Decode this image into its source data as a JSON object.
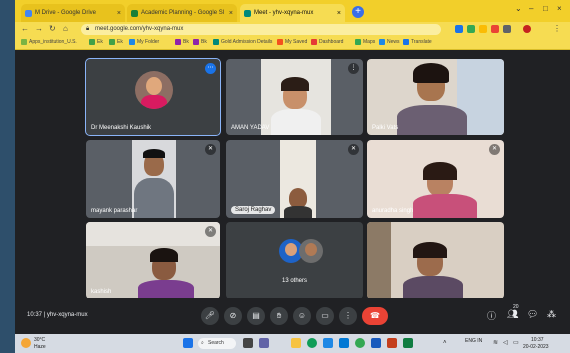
{
  "browser": {
    "tabs": [
      {
        "label": "M Drive - Google Drive",
        "color": "#4285f4"
      },
      {
        "label": "Academic Planning - Google Sl",
        "color": "#188038"
      },
      {
        "label": "Meet - yhv-xqyna-mux",
        "color": "#00897b"
      }
    ],
    "new_tab": "+",
    "url": "meet.google.com/yhv-xqyna-mux",
    "bookmarks": [
      "Apps_institution_U.S.",
      "Ek",
      "Ek",
      "My Folder",
      "Bk",
      "Bk",
      "Gold Admission Details",
      "My Saved",
      "Dashboard",
      "Maps",
      "News",
      "Translate"
    ]
  },
  "meet": {
    "participants": [
      {
        "name": "Dr Meenakshi Kaushik"
      },
      {
        "name": "AMAN YADAV"
      },
      {
        "name": "Palki Vats"
      },
      {
        "name": "mayank parashar"
      },
      {
        "name": "Saroj Raghav"
      },
      {
        "name": "anuradha singh"
      },
      {
        "name": "kashish"
      },
      {
        "name": "13 others"
      },
      {
        "name": ""
      }
    ],
    "time": "10:37",
    "code": "yhv-xqyna-mux",
    "people_count": "20",
    "end_call_color": "#ea4335",
    "accent": "#8ab4f8"
  },
  "taskbar": {
    "weather_temp": "30°C",
    "weather_text": "Haze",
    "search_label": "Search",
    "lang": "ENG IN",
    "time": "10:37",
    "date": "20-02-2023"
  }
}
